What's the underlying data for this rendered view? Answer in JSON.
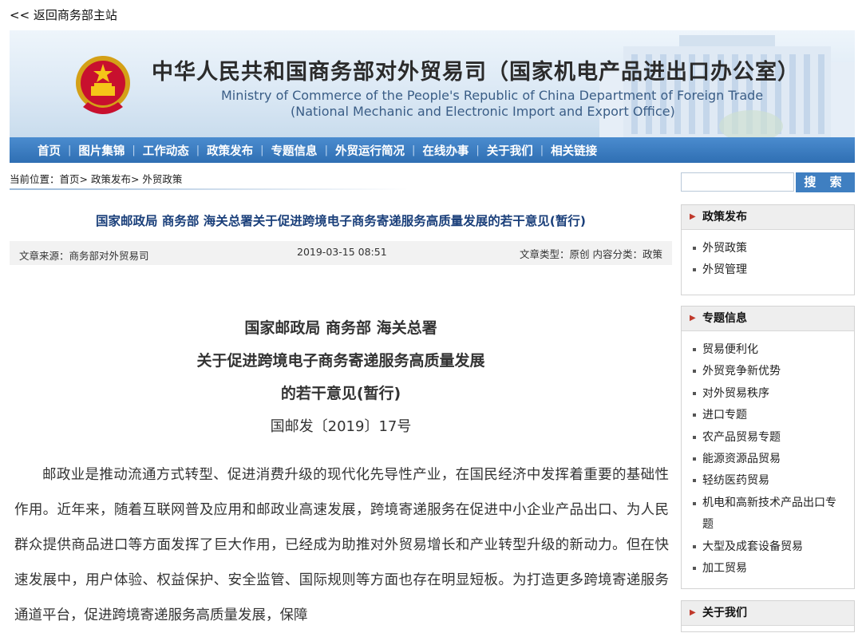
{
  "topbar": {
    "back_link": "<< 返回商务部主站"
  },
  "banner": {
    "title_cn": "中华人民共和国商务部对外贸易司（国家机电产品进出口办公室）",
    "title_en_line1": "Ministry of Commerce of the People's Republic of China Department of Foreign Trade",
    "title_en_line2": "(National Mechanic and Electronic Import and Export Office)"
  },
  "nav": [
    "首页",
    "图片集锦",
    "工作动态",
    "政策发布",
    "专题信息",
    "外贸运行简况",
    "在线办事",
    "关于我们",
    "相关链接"
  ],
  "breadcrumb": "当前位置：首页> 政策发布> 外贸政策",
  "article": {
    "title": "国家邮政局 商务部 海关总署关于促进跨境电子商务寄递服务高质量发展的若干意见(暂行)",
    "meta": {
      "source": "文章来源：商务部对外贸易司",
      "date": "2019-03-15 08:51",
      "type": "文章类型：原创 内容分类：政策"
    },
    "doc_heading": [
      "国家邮政局 商务部 海关总署",
      "关于促进跨境电子商务寄递服务高质量发展",
      "的若干意见(暂行)"
    ],
    "doc_number": "国邮发〔2019〕17号",
    "body": "邮政业是推动流通方式转型、促进消费升级的现代化先导性产业，在国民经济中发挥着重要的基础性作用。近年来，随着互联网普及应用和邮政业高速发展，跨境寄递服务在促进中小企业产品出口、为人民群众提供商品进口等方面发挥了巨大作用，已经成为助推对外贸易增长和产业转型升级的新动力。但在快速发展中，用户体验、权益保护、安全监管、国际规则等方面也存在明显短板。为打造更多跨境寄递服务通道平台，促进跨境寄递服务高质量发展，保障"
  },
  "sidebar": {
    "search_button": "搜 索",
    "policy": {
      "title": "政策发布",
      "items": [
        "外贸政策",
        "外贸管理"
      ]
    },
    "topics": {
      "title": "专题信息",
      "items": [
        "贸易便利化",
        "外贸竞争新优势",
        "对外贸易秩序",
        "进口专题",
        "农产品贸易专题",
        "能源资源品贸易",
        "轻纺医药贸易",
        "机电和高新技术产品出口专题",
        "大型及成套设备贸易",
        "加工贸易"
      ]
    },
    "about": {
      "title": "关于我们"
    }
  },
  "colors": {
    "nav_blue": "#2f6fb3",
    "title_blue": "#1a3f7a",
    "search_blue": "#3f7fc1"
  }
}
